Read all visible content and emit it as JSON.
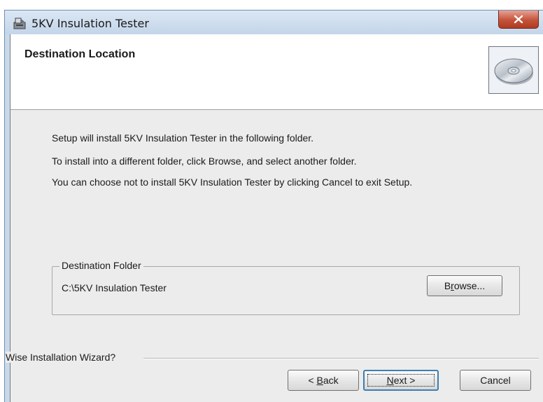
{
  "window": {
    "title": "5KV Insulation Tester",
    "close_label": "x"
  },
  "header": {
    "title": "Destination Location",
    "icon": "cd-disc-icon"
  },
  "body": {
    "line1": "Setup will install 5KV Insulation Tester in the following folder.",
    "line2": "To install into a different folder, click Browse, and select another folder.",
    "line3": "You can choose not to install 5KV Insulation Tester by clicking Cancel to exit Setup."
  },
  "destination": {
    "legend": "Destination Folder",
    "path": "C:\\5KV Insulation Tester",
    "browse_label_pre": "B",
    "browse_label_key": "r",
    "browse_label_post": "owse..."
  },
  "footer": {
    "wizard_label": "Wise Installation Wizard?",
    "back_pre": "< ",
    "back_key": "B",
    "back_post": "ack",
    "next_key": "N",
    "next_post": "ext >",
    "cancel_label": "Cancel"
  },
  "colors": {
    "title_bar": "#c9d9ea",
    "close_button": "#c4533a",
    "dialog_body": "#ececec",
    "focus_border": "#3c7fb1"
  }
}
